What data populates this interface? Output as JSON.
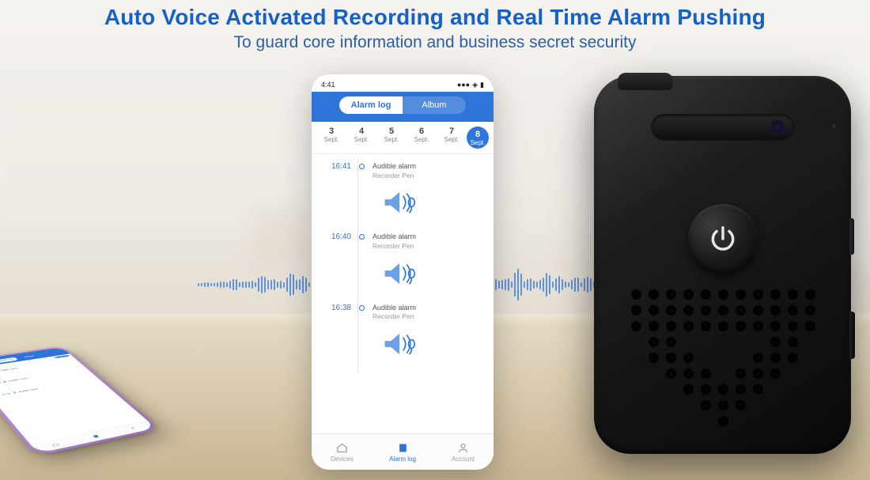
{
  "hero": {
    "title": "Auto Voice Activated Recording and Real Time Alarm Pushing",
    "subtitle": "To guard core information and business secret security"
  },
  "phone": {
    "time": "4:41",
    "tabs": {
      "alarm": "Alarm log",
      "album": "Album"
    },
    "dates": [
      {
        "d": "3",
        "m": "Sept."
      },
      {
        "d": "4",
        "m": "Sept."
      },
      {
        "d": "5",
        "m": "Sept."
      },
      {
        "d": "6",
        "m": "Sept."
      },
      {
        "d": "7",
        "m": "Sept."
      },
      {
        "d": "8",
        "m": "Sept."
      }
    ],
    "log": [
      {
        "t": "16:41",
        "title": "Audible alarm",
        "sub": "Recorder Pen"
      },
      {
        "t": "16:40",
        "title": "Audible alarm",
        "sub": "Recorder Pen"
      },
      {
        "t": "16:38",
        "title": "Audible alarm",
        "sub": "Recorder Pen"
      }
    ],
    "nav": {
      "devices": "Devices",
      "alarm": "Alarm log",
      "account": "Account"
    }
  },
  "colors": {
    "brand": "#2f74d8",
    "title": "#1561c6"
  }
}
